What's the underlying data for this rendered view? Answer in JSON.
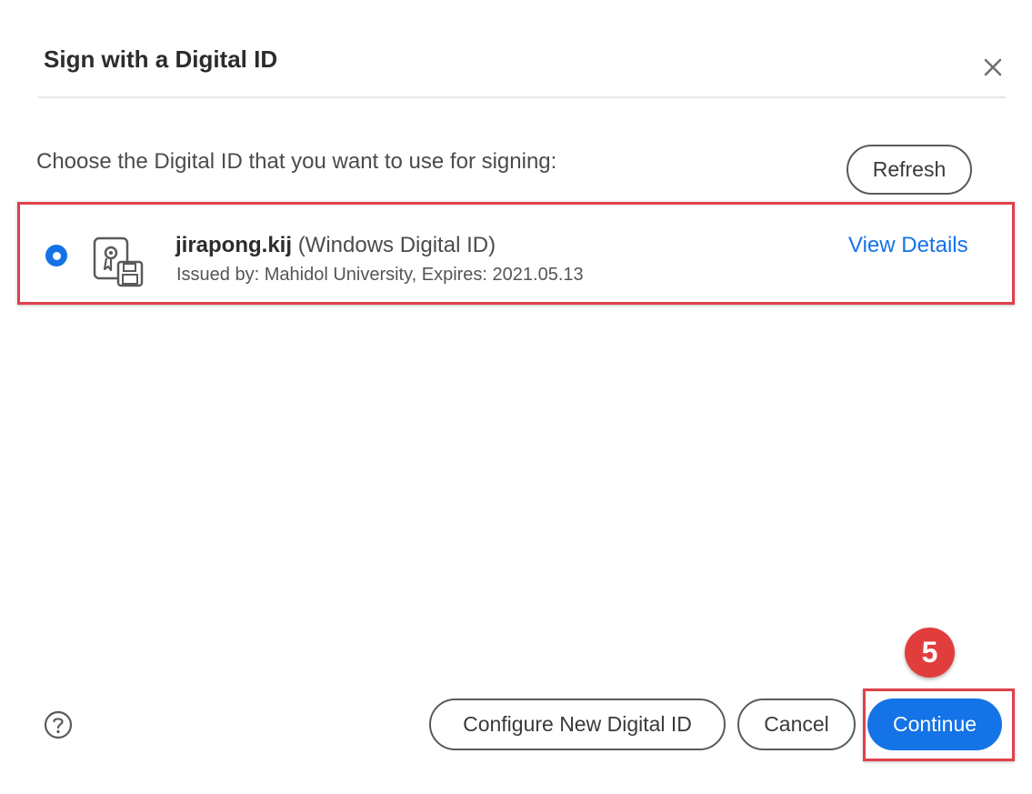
{
  "dialog": {
    "title": "Sign with a Digital ID",
    "instruction": "Choose the Digital ID that you want to use for signing:",
    "refresh_label": "Refresh"
  },
  "digital_id": {
    "name": "jirapong.kij",
    "type": "(Windows Digital ID)",
    "issuer": "Issued by: Mahidol University, Expires: 2021.05.13",
    "view_details_label": "View Details",
    "selected": true
  },
  "footer": {
    "configure_label": "Configure New Digital ID",
    "cancel_label": "Cancel",
    "continue_label": "Continue"
  },
  "annotation": {
    "step_number": "5"
  },
  "icons": {
    "close": "close-icon",
    "certificate": "certificate-icon",
    "help": "help-icon"
  },
  "colors": {
    "accent": "#1473e6",
    "highlight": "#e0414b",
    "badge": "#e23d3d"
  }
}
